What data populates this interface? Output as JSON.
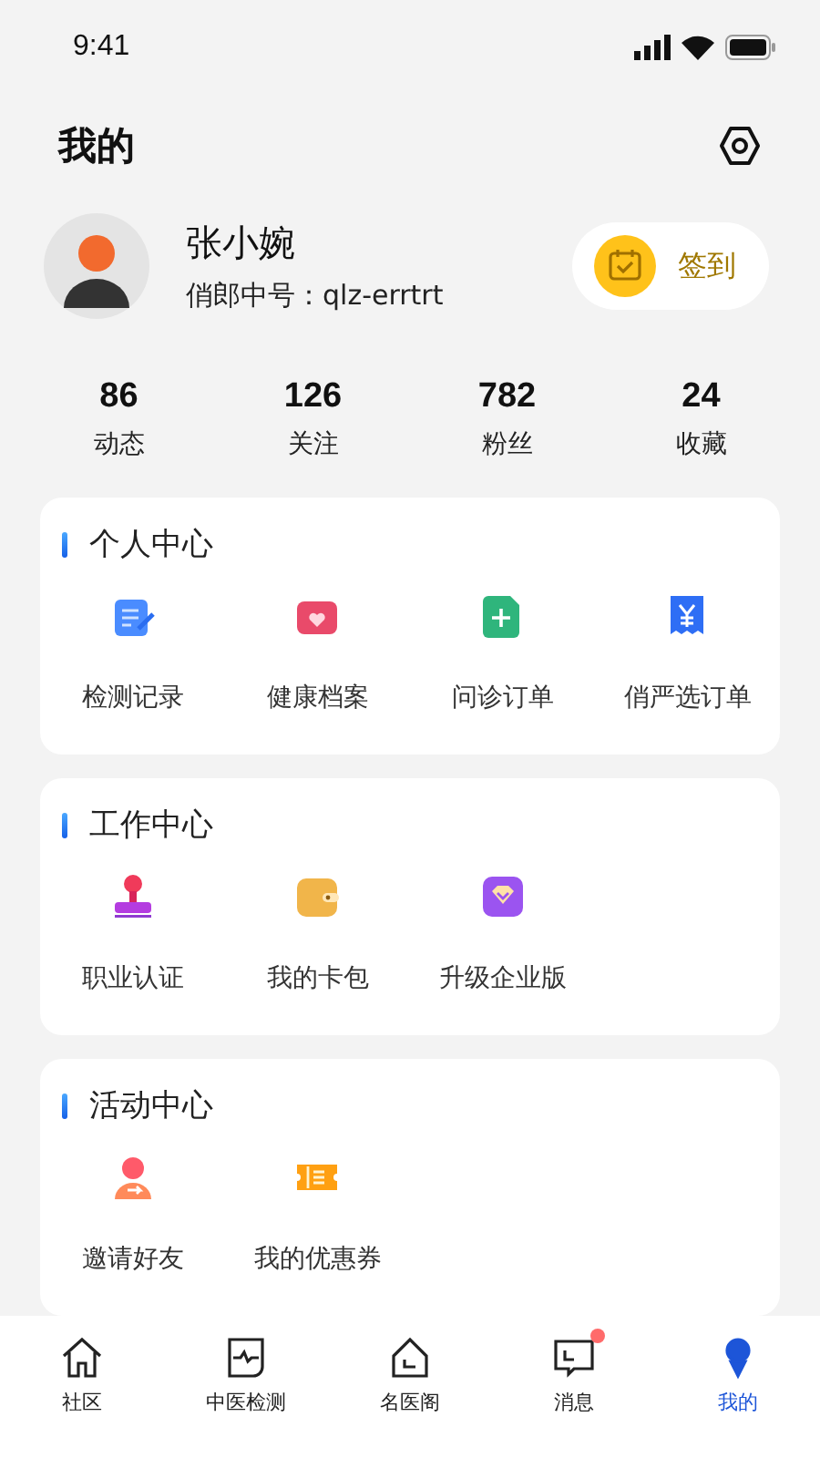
{
  "status_bar": {
    "time": "9:41"
  },
  "header": {
    "title": "我的"
  },
  "profile": {
    "name": "张小婉",
    "account_label": "俏郎中号：qlz-errtrt",
    "checkin": {
      "label": "签到"
    }
  },
  "stats": [
    {
      "value": "86",
      "label": "动态"
    },
    {
      "value": "126",
      "label": "关注"
    },
    {
      "value": "782",
      "label": "粉丝"
    },
    {
      "value": "24",
      "label": "收藏"
    }
  ],
  "sections": [
    {
      "title": "个人中心",
      "items": [
        {
          "kind": "record",
          "label": "检测记录"
        },
        {
          "kind": "health",
          "label": "健康档案"
        },
        {
          "kind": "consult",
          "label": "问诊订单"
        },
        {
          "kind": "order",
          "label": "俏严选订单"
        }
      ]
    },
    {
      "title": "工作中心",
      "items": [
        {
          "kind": "stamp",
          "label": "职业认证"
        },
        {
          "kind": "wallet",
          "label": "我的卡包"
        },
        {
          "kind": "diamond",
          "label": "升级企业版"
        }
      ]
    },
    {
      "title": "活动中心",
      "items": [
        {
          "kind": "invite",
          "label": "邀请好友"
        },
        {
          "kind": "coupon",
          "label": "我的优惠券"
        }
      ]
    }
  ],
  "tab_bar": [
    {
      "kind": "home",
      "label": "社区",
      "selected": false,
      "badge": false
    },
    {
      "kind": "pulse",
      "label": "中医检测",
      "selected": false,
      "badge": false
    },
    {
      "kind": "hall",
      "label": "名医阁",
      "selected": false,
      "badge": false
    },
    {
      "kind": "message",
      "label": "消息",
      "selected": false,
      "badge": true
    },
    {
      "kind": "me",
      "label": "我的",
      "selected": true,
      "badge": false
    }
  ]
}
